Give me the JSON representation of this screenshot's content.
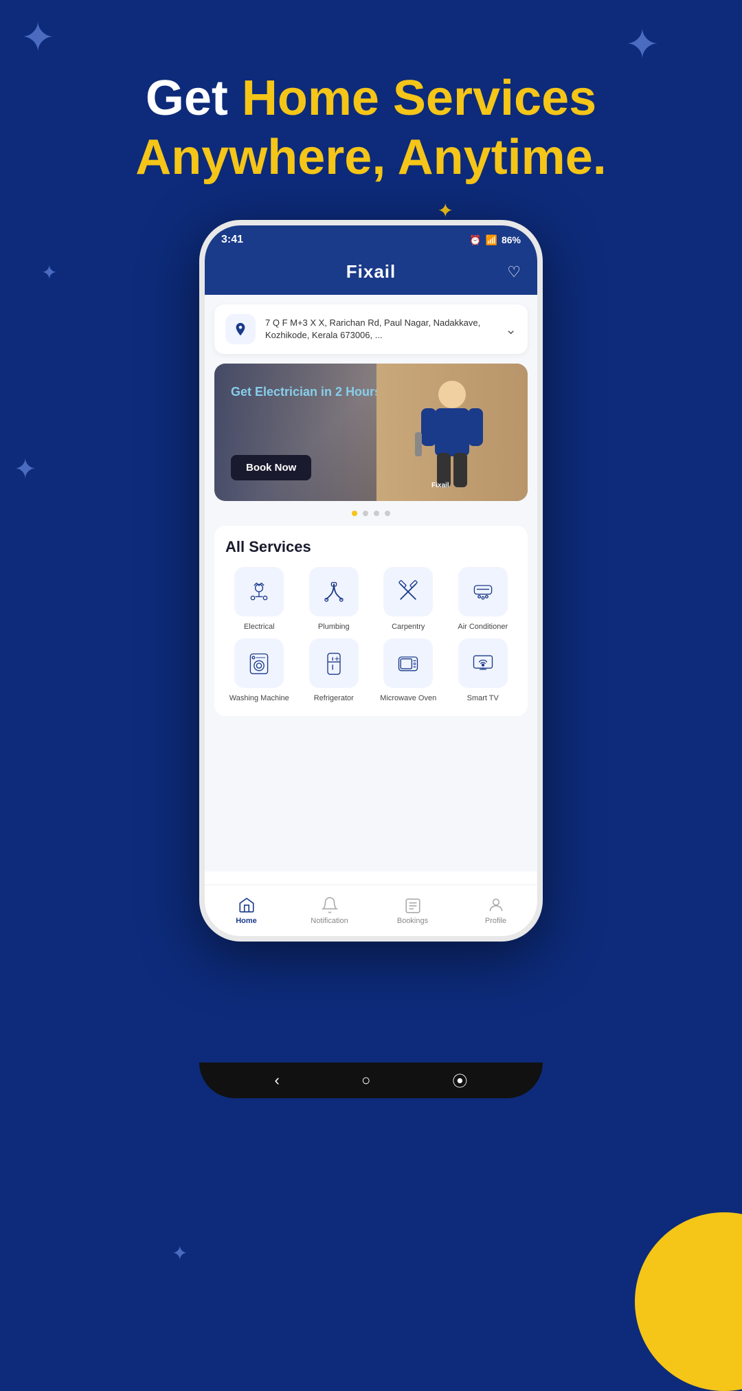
{
  "background": {
    "color": "#0d2b7a"
  },
  "hero": {
    "line1_static": "Get ",
    "line1_highlight": "Home Services",
    "line2": "Anywhere, Anytime."
  },
  "phone": {
    "status_bar": {
      "time": "3:41",
      "battery": "86%",
      "signal_icons": "📶"
    },
    "header": {
      "title": "Fixail",
      "heart_icon": "heart-icon"
    },
    "address": {
      "text": "7 Q F M+3 X X, Rarichan Rd, Paul Nagar, Nadakkave, Kozhikode, Kerala 673006, ..."
    },
    "banner": {
      "headline": "Get Electrician in 2 Hours",
      "button_label": "Book Now",
      "brand_label": "Fixail"
    },
    "carousel_dots": [
      {
        "active": true
      },
      {
        "active": false
      },
      {
        "active": false
      },
      {
        "active": false
      }
    ],
    "all_services": {
      "title": "All Services",
      "items": [
        {
          "label": "Electrical",
          "icon": "electrical-icon"
        },
        {
          "label": "Plumbing",
          "icon": "plumbing-icon"
        },
        {
          "label": "Carpentry",
          "icon": "carpentry-icon"
        },
        {
          "label": "Air Conditioner",
          "icon": "ac-icon"
        },
        {
          "label": "Washing Machine",
          "icon": "washing-machine-icon"
        },
        {
          "label": "Refrigerator",
          "icon": "refrigerator-icon"
        },
        {
          "label": "Microwave Oven",
          "icon": "microwave-icon"
        },
        {
          "label": "Smart TV",
          "icon": "smart-tv-icon"
        }
      ]
    },
    "bottom_nav": [
      {
        "label": "Home",
        "icon": "home-icon",
        "active": true
      },
      {
        "label": "Notification",
        "icon": "notification-icon",
        "active": false
      },
      {
        "label": "Bookings",
        "icon": "bookings-icon",
        "active": false
      },
      {
        "label": "Profile",
        "icon": "profile-icon",
        "active": false
      }
    ]
  }
}
